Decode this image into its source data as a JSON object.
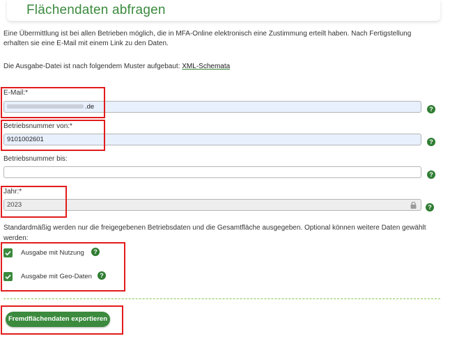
{
  "page": {
    "title": "Flächendaten abfragen",
    "intro": "Eine Übermittlung ist bei allen Betrieben möglich, die in MFA-Online elektronisch eine Zustimmung erteilt haben. Nach Fertigstellung erhalten sie eine E-Mail mit einem Link zu den Daten.",
    "intro2_prefix": "Die Ausgabe-Datei ist nach folgendem Muster aufgebaut: ",
    "xml_link": "XML-Schemata"
  },
  "form": {
    "email": {
      "label": "E-Mail:*",
      "value_suffix": ".de"
    },
    "betrieb_von": {
      "label": "Betriebsnummer von:*",
      "value": "9101002601"
    },
    "betrieb_bis": {
      "label": "Betriebsnummer bis:",
      "value": ""
    },
    "jahr": {
      "label": "Jahr:*",
      "value": "2023"
    },
    "help_glyph": "?",
    "note": "Standardmäßig werden nur die freigegebenen Betriebsdaten und die Gesamtfläche ausgegeben. Optional können weitere Daten gewählt werden:",
    "checkboxes": [
      {
        "label": "Ausgabe mit Nutzung",
        "checked": true
      },
      {
        "label": "Ausgabe mit Geo-Daten",
        "checked": true
      }
    ],
    "submit_label": "Fremdflächendaten exportieren"
  },
  "colors": {
    "accent": "#3b8a3e",
    "highlight": "#e21b1b",
    "autofill": "#e8f0fe"
  }
}
